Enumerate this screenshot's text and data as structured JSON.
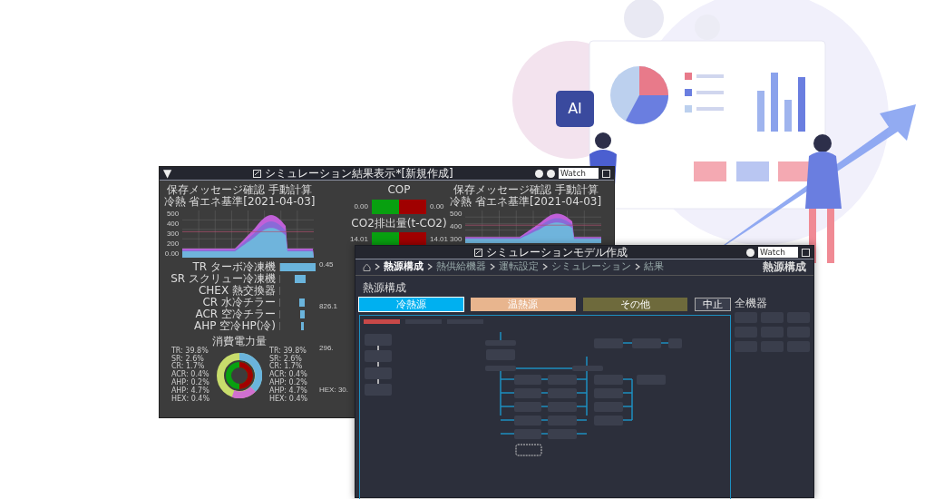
{
  "illustration": {
    "chip_label": "AI"
  },
  "result_window": {
    "menu_glyph": "▼",
    "title": "シミュレーション結果表示*[新規作成]",
    "search": {
      "value": "Watch"
    },
    "charts": [
      {
        "title": "保存メッセージ確認 手動計算",
        "subtitle": "冷熱 省エネ基準[2021-04-03]",
        "yticks": [
          "500",
          "400",
          "300",
          "200",
          "0.00"
        ]
      },
      {
        "title": "保存メッセージ確認 手動計算",
        "subtitle": "冷熱 省エネ基準[2021-04-03]",
        "yticks": [
          "500",
          "400",
          "300"
        ]
      }
    ],
    "meters": [
      {
        "title": "COP",
        "left_reading": "0.00",
        "right_reading": "0.00",
        "level": 0.5
      },
      {
        "title": "CO2排出量(t-CO2)",
        "left_reading": "14.01",
        "right_reading": "14.01",
        "level": 0.5
      }
    ],
    "bars": [
      {
        "label": "TR ターボ冷凍機"
      },
      {
        "label": "SR スクリュー冷凍機"
      },
      {
        "label": "CHEX 熱交換器"
      },
      {
        "label": "CR 水冷チラー"
      },
      {
        "label": "ACR 空冷チラー"
      },
      {
        "label": "AHP 空冷HP(冷)"
      }
    ],
    "side_readings": [
      "0.45",
      "826.1",
      "296.",
      "HEX: 30."
    ],
    "donut": {
      "title": "消費電力量",
      "legend_left": [
        "TR: 39.8%",
        "SR: 2.6%",
        "CR: 1.7%",
        "ACR: 0.4%",
        "AHP: 0.2%",
        "AHP: 4.7%",
        "HEX: 0.4%"
      ],
      "legend_right": [
        "TR: 39.8%",
        "SR: 2.6%",
        "CR: 1.7%",
        "ACR: 0.4%",
        "AHP: 0.2%",
        "AHP: 4.7%",
        "HEX: 0.4%"
      ]
    }
  },
  "model_window": {
    "title": "シミュレーションモデル作成",
    "search": {
      "value": "Watch"
    },
    "breadcrumb": [
      {
        "label": "熱源構成",
        "selected": true
      },
      {
        "label": "熱供給機器",
        "selected": false
      },
      {
        "label": "運転設定",
        "selected": false
      },
      {
        "label": "シミュレーション",
        "selected": false
      },
      {
        "label": "結果",
        "selected": false
      }
    ],
    "page_title": "熱源構成",
    "section_title": "熱源構成",
    "tabs": [
      {
        "label": "冷熱源",
        "selected": true,
        "color": "#00b0f0"
      },
      {
        "label": "温熱源",
        "selected": false,
        "color": "#e8b58e"
      },
      {
        "label": "その他",
        "selected": false,
        "color": "#6e6a3c"
      }
    ],
    "stop_button": "中止",
    "side_heading": "全機器"
  }
}
